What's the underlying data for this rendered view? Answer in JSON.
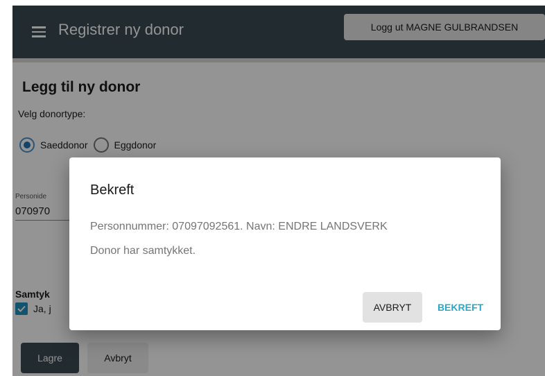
{
  "appbar": {
    "title": "Registrer ny donor",
    "logout_label": "Logg ut MAGNE GULBRANDSEN"
  },
  "form": {
    "title": "Legg til ny donor",
    "donor_type_label": "Velg donortype:",
    "donor_types": [
      {
        "label": "Saeddonor",
        "selected": true
      },
      {
        "label": "Eggdonor",
        "selected": false
      }
    ],
    "person_id_label": "Personide",
    "person_id_value": "070970",
    "consent_heading": "Samtyk",
    "consent_checkbox_label": "Ja, j",
    "consent_checked": true,
    "save_label": "Lagre",
    "cancel_label": "Avbryt"
  },
  "dialog": {
    "title": "Bekreft",
    "line1": "Personnummer: 07097092561. Navn: ENDRE LANDSVERK",
    "line2": "Donor har samtykket.",
    "cancel_label": "AVBRYT",
    "confirm_label": "BEKREFT"
  },
  "colors": {
    "appbar": "#3b4a53",
    "accent": "#26a9c9",
    "radio": "#1f76b8"
  }
}
